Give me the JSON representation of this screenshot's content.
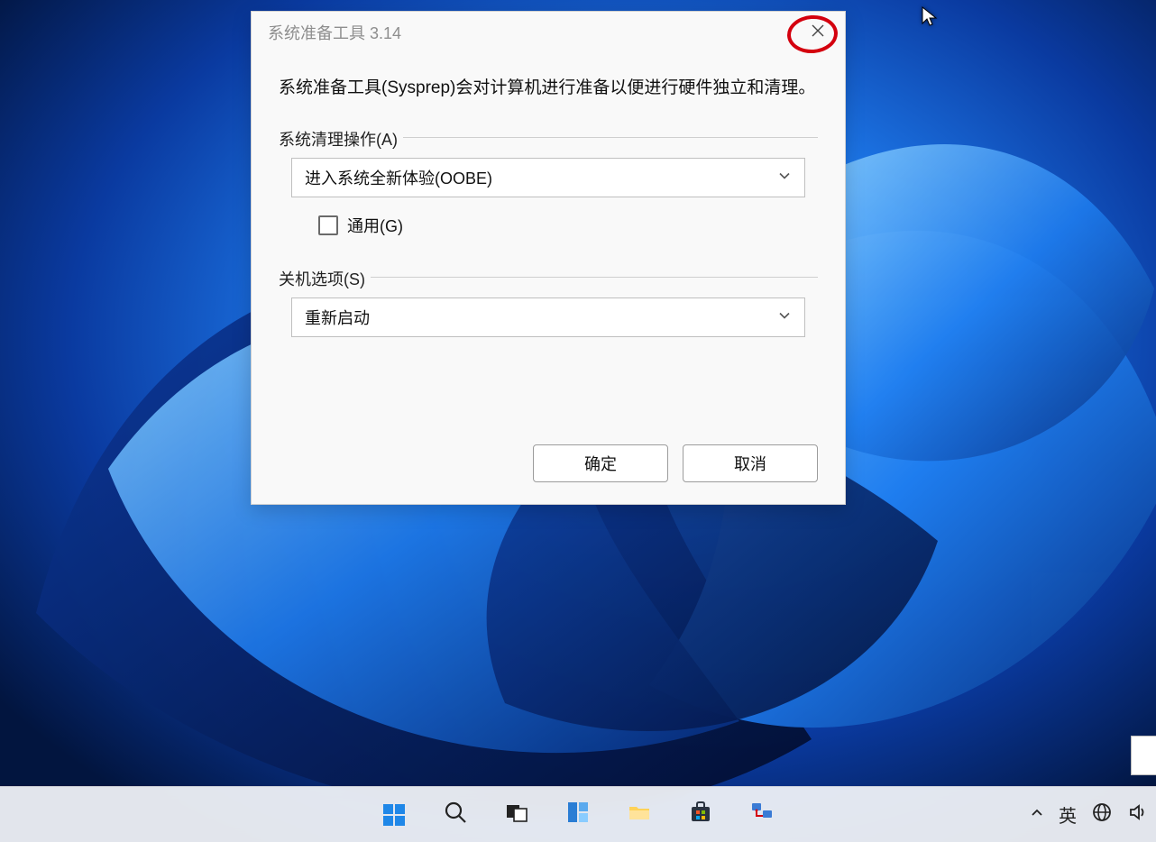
{
  "dialog": {
    "title": "系统准备工具 3.14",
    "description": "系统准备工具(Sysprep)会对计算机进行准备以便进行硬件独立和清理。",
    "group_cleanup": {
      "label": "系统清理操作(A)",
      "selected": "进入系统全新体验(OOBE)",
      "generalize_label": "通用(G)"
    },
    "group_shutdown": {
      "label": "关机选项(S)",
      "selected": "重新启动"
    },
    "ok_label": "确定",
    "cancel_label": "取消"
  },
  "taskbar": {
    "ime_label": "英"
  }
}
